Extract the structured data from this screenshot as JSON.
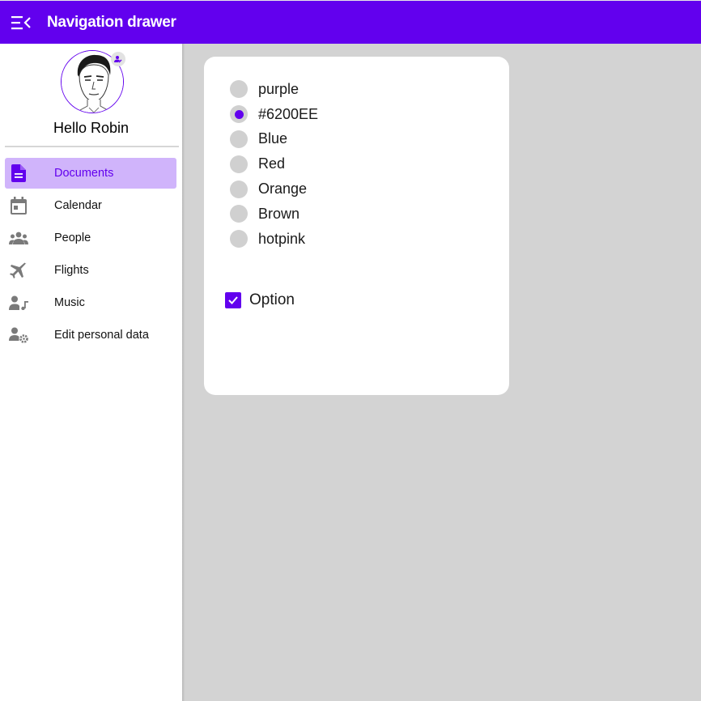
{
  "appbar": {
    "title": "Navigation drawer",
    "menu_icon": "menu-open-icon",
    "background": "#6200EE"
  },
  "drawer": {
    "greeting": "Hello Robin",
    "avatar_badge_icon": "person-edit-icon",
    "items": [
      {
        "label": "Documents",
        "icon": "document-icon",
        "active": true
      },
      {
        "label": "Calendar",
        "icon": "calendar-icon",
        "active": false
      },
      {
        "label": "People",
        "icon": "people-icon",
        "active": false
      },
      {
        "label": "Flights",
        "icon": "airplane-icon",
        "active": false
      },
      {
        "label": "Music",
        "icon": "person-music-icon",
        "active": false
      },
      {
        "label": "Edit personal data",
        "icon": "person-settings-icon",
        "active": false
      }
    ]
  },
  "card": {
    "radios": [
      {
        "label": "purple",
        "selected": false
      },
      {
        "label": "#6200EE",
        "selected": true
      },
      {
        "label": "Blue",
        "selected": false
      },
      {
        "label": "Red",
        "selected": false
      },
      {
        "label": "Orange",
        "selected": false
      },
      {
        "label": "Brown",
        "selected": false
      },
      {
        "label": "hotpink",
        "selected": false
      }
    ],
    "checkbox": {
      "label": "Option",
      "checked": true
    }
  },
  "colors": {
    "accent": "#6200EE",
    "active_item_bg": "#D0B4FB",
    "page_bg": "#D3D3D3"
  }
}
